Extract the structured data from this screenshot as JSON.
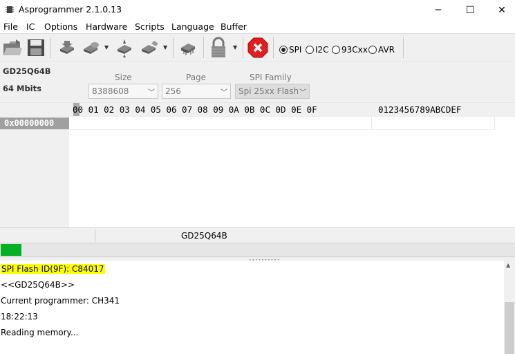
{
  "window": {
    "title": "Asprogrammer 2.1.0.13",
    "minimize_glyph": "─",
    "maximize_glyph": "☐",
    "close_glyph": "✕"
  },
  "menu": {
    "items": [
      "File",
      "IC",
      "Options",
      "Hardware",
      "Scripts",
      "Language",
      "Buffer"
    ]
  },
  "toolbar": {
    "buttons": [
      "open-file-icon",
      "save-file-icon",
      "read-chip-icon",
      "write-chip-icon",
      "verify-chip-icon",
      "erase-chip-icon",
      "chip-icon",
      "lock-icon",
      "stop-icon"
    ],
    "protocols": {
      "options": [
        "SPI",
        "I2C",
        "93Cxx",
        "AVR"
      ],
      "selected": "SPI"
    }
  },
  "info": {
    "chip_name": "GD25Q64B",
    "chip_capacity": "64 Mbits",
    "size_label": "Size",
    "size_value": "8388608",
    "page_label": "Page",
    "page_value": "256",
    "family_label": "SPI Family",
    "family_value": "Spi 25xx Flash"
  },
  "hex": {
    "cursor_digit": "0",
    "header_rest": "0 01 02 03 04 05 06 07 08 09 0A 0B 0C 0D 0E 0F",
    "ascii_header": "0123456789ABCDEF",
    "first_address": "0x00000000"
  },
  "status": {
    "chip": "GD25Q64B"
  },
  "progress": {
    "fraction": 0.04
  },
  "log": {
    "lines": [
      "SPI Flash ID(9F): C84017",
      "<<GD25Q64B>>",
      "Current programmer: CH341",
      "18:22:13",
      "Reading memory..."
    ]
  },
  "colors": {
    "progress": "#06b025",
    "highlight": "#ffff00",
    "stop_red": "#e02020"
  }
}
